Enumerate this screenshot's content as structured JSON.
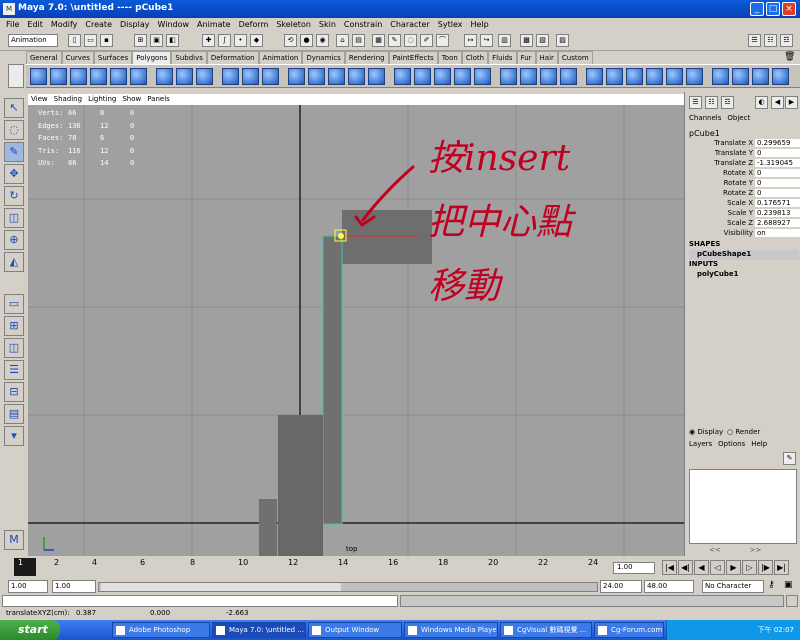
{
  "window": {
    "title": "Maya 7.0: \\untitled   ----   pCube1"
  },
  "menubar": [
    "File",
    "Edit",
    "Modify",
    "Create",
    "Display",
    "Window",
    "Animate",
    "Deform",
    "Skeleton",
    "Skin",
    "Constrain",
    "Character",
    "Sytlex",
    "Help"
  ],
  "status": {
    "mode": "Animation"
  },
  "shelf_tabs": [
    "General",
    "Curves",
    "Surfaces",
    "Polygons",
    "Subdivs",
    "Deformation",
    "Animation",
    "Dynamics",
    "Rendering",
    "PaintEffects",
    "Toon",
    "Cloth",
    "Fluids",
    "Fur",
    "Hair",
    "Custom"
  ],
  "shelf_active": "Polygons",
  "panel_menu": [
    "View",
    "Shading",
    "Lighting",
    "Show",
    "Panels"
  ],
  "hud": [
    [
      "Verts:",
      "66",
      "8",
      "0"
    ],
    [
      "Edges:",
      "136",
      "12",
      "0"
    ],
    [
      "Faces:",
      "78",
      "6",
      "0"
    ],
    [
      "Tris:",
      "116",
      "12",
      "0"
    ],
    [
      "UVs:",
      "86",
      "14",
      "0"
    ]
  ],
  "viewport_label": "top",
  "annotation": {
    "line1": "按insert",
    "line2": "把中心點",
    "line3": "移動"
  },
  "channel_box": {
    "menu": [
      "Channels",
      "Object"
    ],
    "object": "pCube1",
    "attrs": [
      {
        "name": "Translate X",
        "value": "0.299659"
      },
      {
        "name": "Translate Y",
        "value": "0"
      },
      {
        "name": "Translate Z",
        "value": "-1.319045"
      },
      {
        "name": "Rotate X",
        "value": "0"
      },
      {
        "name": "Rotate Y",
        "value": "0"
      },
      {
        "name": "Rotate Z",
        "value": "0"
      },
      {
        "name": "Scale X",
        "value": "0.176571"
      },
      {
        "name": "Scale Y",
        "value": "0.239813"
      },
      {
        "name": "Scale Z",
        "value": "2.688927"
      },
      {
        "name": "Visibility",
        "value": "on"
      }
    ],
    "shapes_label": "SHAPES",
    "shape": "pCubeShape1",
    "inputs_label": "INPUTS",
    "input": "polyCube1"
  },
  "layer_editor": {
    "display": "Display",
    "render": "Render",
    "menu": [
      "Layers",
      "Options",
      "Help"
    ]
  },
  "timeline": {
    "ticks": [
      "1",
      "2",
      "4",
      "6",
      "8",
      "10",
      "12",
      "14",
      "16",
      "18",
      "20",
      "22",
      "24"
    ],
    "current": "1.00"
  },
  "range": {
    "start": "1.00",
    "start2": "1.00",
    "end": "24.00",
    "end2": "48.00",
    "charset": "No Character Set"
  },
  "helpline": {
    "label": "translateXYZ(cm):",
    "x": "0.387",
    "y": "0.000",
    "z": "-2.663"
  },
  "taskbar": {
    "start": "start",
    "items": [
      "Adobe Photoshop",
      "Maya 7.0: \\untitled ...",
      "Output Window",
      "Windows Media Player",
      "CgVisual 數碼視覺 ...",
      "Cg-Forum.com : 觀..."
    ],
    "clock": "下午 02:07"
  }
}
